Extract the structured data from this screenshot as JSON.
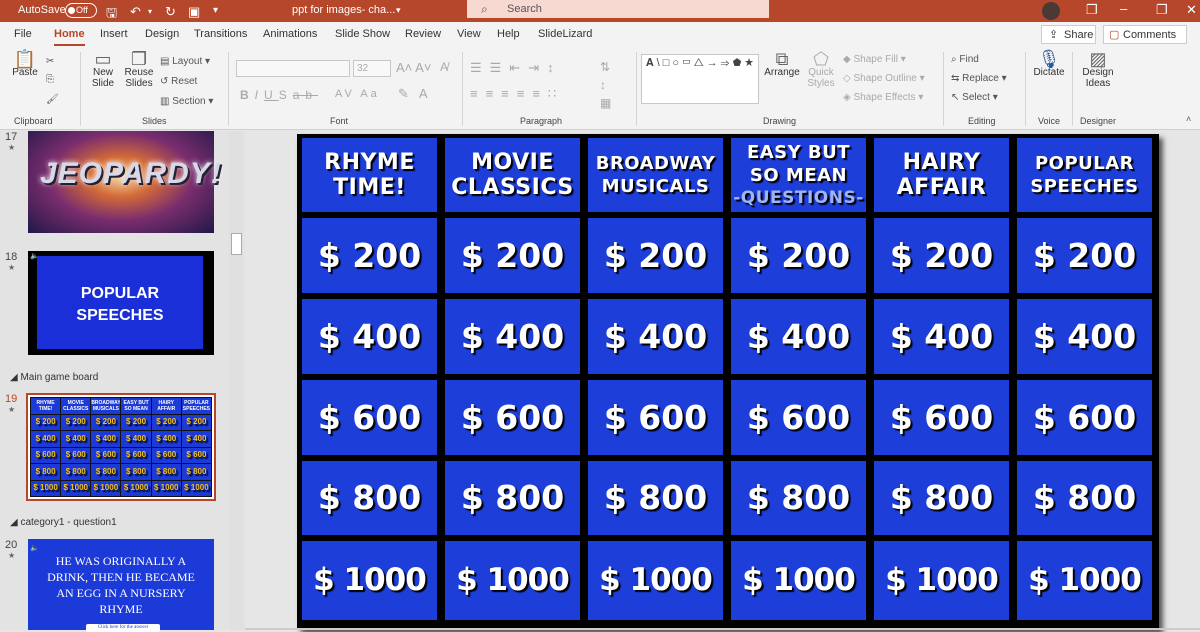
{
  "titlebar": {
    "autosave_label": "AutoSave",
    "autosave_state": "Off",
    "doc_title": "ppt for images- cha...",
    "search_placeholder": "Search"
  },
  "menu": {
    "tabs": [
      "File",
      "Home",
      "Insert",
      "Design",
      "Transitions",
      "Animations",
      "Slide Show",
      "Review",
      "View",
      "Help",
      "SlideLizard"
    ],
    "active_tab": "Home",
    "share_label": "Share",
    "comments_label": "Comments"
  },
  "ribbon": {
    "clipboard": {
      "paste": "Paste",
      "label": "Clipboard"
    },
    "slides": {
      "new_slide": "New Slide",
      "reuse_slides": "Reuse Slides",
      "layout": "Layout",
      "reset": "Reset",
      "section": "Section",
      "label": "Slides"
    },
    "font": {
      "size": "32",
      "label": "Font"
    },
    "paragraph": {
      "label": "Paragraph"
    },
    "drawing": {
      "arrange": "Arrange",
      "quick_styles": "Quick Styles",
      "shape_fill": "Shape Fill",
      "shape_outline": "Shape Outline",
      "shape_effects": "Shape Effects",
      "label": "Drawing"
    },
    "editing": {
      "find": "Find",
      "replace": "Replace",
      "select": "Select",
      "label": "Editing"
    },
    "voice": {
      "dictate": "Dictate",
      "label": "Voice"
    },
    "designer": {
      "design_ideas": "Design Ideas",
      "label": "Designer"
    }
  },
  "slides_panel": {
    "slide17": {
      "num": "17",
      "logo_text": "JEOPARDY!"
    },
    "slide18": {
      "num": "18",
      "text": "POPULAR SPEECHES"
    },
    "section_main": "Main game board",
    "slide19": {
      "num": "19"
    },
    "section_cat": "category1 - question1",
    "slide20": {
      "num": "20",
      "text": "HE WAS ORIGINALLY A DRINK, THEN HE BECAME AN EGG IN A NURSERY RHYME",
      "link": "Click here for the answer"
    }
  },
  "board": {
    "categories": [
      {
        "line1": "RHYME",
        "line2": "TIME!",
        "line3": ""
      },
      {
        "line1": "MOVIE",
        "line2": "CLASSICS",
        "line3": ""
      },
      {
        "line1": "BROADWAY",
        "line2": "MUSICALS",
        "line3": ""
      },
      {
        "line1": "EASY BUT",
        "line2": "SO MEAN",
        "line3": "-QUESTIONS-"
      },
      {
        "line1": "HAIRY",
        "line2": "AFFAIR",
        "line3": ""
      },
      {
        "line1": "POPULAR",
        "line2": "SPEECHES",
        "line3": ""
      }
    ],
    "values": [
      "$ 200",
      "$ 400",
      "$ 600",
      "$ 800",
      "$ 1000"
    ],
    "colors": {
      "cell": "#1d3ed8",
      "value_text": "#f7c325",
      "grid": "#000000"
    }
  }
}
